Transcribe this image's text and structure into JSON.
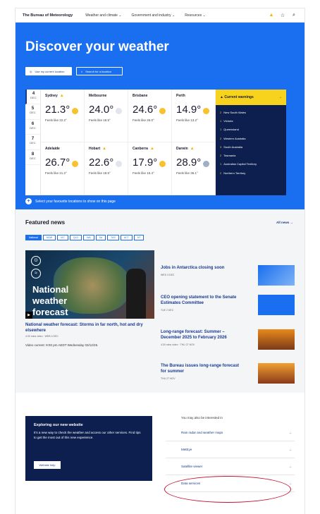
{
  "nav": {
    "brand": "The Bureau of Meteorology",
    "items": [
      "Weather and climate ⌄",
      "Government and industry ⌄",
      "Resources ⌄"
    ],
    "warning_icon": "▲",
    "star_icon": "☆",
    "search_icon": "⌕"
  },
  "hero": {
    "title": "Discover your weather",
    "use_location": "Use my current location",
    "search_location": "Search for a location",
    "favourite_prompt": "Select your favourite locations to show on this page"
  },
  "days": [
    {
      "num": "4",
      "mon": "DEC"
    },
    {
      "num": "5",
      "mon": "DEC"
    },
    {
      "num": "6",
      "mon": "DEC"
    },
    {
      "num": "7",
      "mon": "DEC"
    },
    {
      "num": "8",
      "mon": "DEC"
    }
  ],
  "cities": [
    {
      "name": "Sydney",
      "temp": "21.3°",
      "feels": "Feels like 22.2°"
    },
    {
      "name": "Melbourne",
      "temp": "24.0°",
      "feels": "Feels like 18.5°"
    },
    {
      "name": "Brisbane",
      "temp": "24.6°",
      "feels": "Feels like 26.0°"
    },
    {
      "name": "Perth",
      "temp": "14.9°",
      "feels": "Feels like 13.2°"
    },
    {
      "name": "Adelaide",
      "temp": "26.7°",
      "feels": "Feels like 21.2°"
    },
    {
      "name": "Hobart",
      "temp": "22.6°",
      "feels": "Feels like 18.5°"
    },
    {
      "name": "Canberra",
      "temp": "17.9°",
      "feels": "Feels like 15.4°"
    },
    {
      "name": "Darwin",
      "temp": "28.9°",
      "feels": "Feels like 36.1°"
    }
  ],
  "warnings": {
    "title": "Current warnings",
    "items": [
      {
        "n": "2",
        "label": "New South Wales"
      },
      {
        "n": "1",
        "label": "Victoria"
      },
      {
        "n": "1",
        "label": "Queensland"
      },
      {
        "n": "2",
        "label": "Western Australia"
      },
      {
        "n": "3",
        "label": "South Australia"
      },
      {
        "n": "2",
        "label": "Tasmania"
      },
      {
        "n": "1",
        "label": "Australian Capital Territory"
      },
      {
        "n": "2",
        "label": "Northern Territory"
      }
    ]
  },
  "news": {
    "title": "Featured news",
    "all_link": "All news →",
    "chips": [
      "National",
      "NSW",
      "VIC",
      "QLD",
      "WA",
      "SA",
      "TAS",
      "ACT",
      "NT"
    ],
    "feature_title": "National weather forecast",
    "feature_caption": "National weather forecast: Storms in far north, hot and dry elsewhere",
    "feature_meta": "4:30 mins video · WEB 4 DEC",
    "feature_video": "Video current: 9:00 pm AEDT Wednesday 03/12/25.",
    "stories": [
      {
        "title": "Jobs in Antarctica closing soon",
        "meta": "WED 3 DEC"
      },
      {
        "title": "CEO opening statement to the Senate Estimates Committee",
        "meta": "TUE 2 DEC"
      },
      {
        "title": "Long-range forecast: Summer – December 2025 to February 2026",
        "meta": "4:30 mins video · THU 27 NOV"
      },
      {
        "title": "The Bureau issues long-range forecast for summer",
        "meta": "THU 27 NOV"
      }
    ]
  },
  "explore": {
    "title": "Exploring our new website",
    "body": "It’s a new way to check the weather and access our other services. Find tips to get the most out of this new experience.",
    "button": "Website help"
  },
  "also": {
    "heading": "You may also be interested in",
    "links": [
      "Rain radar and weather maps",
      "MetEye",
      "Satellite viewer",
      "Data services"
    ]
  }
}
